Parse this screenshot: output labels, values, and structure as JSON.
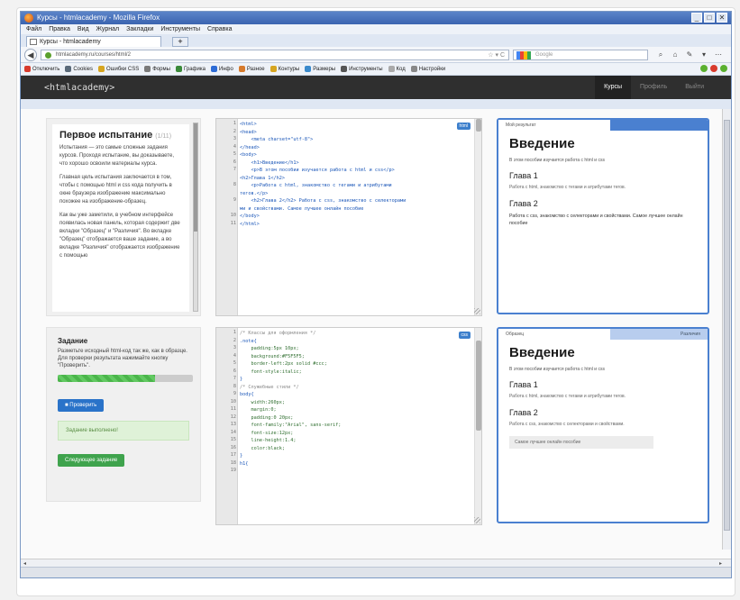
{
  "window": {
    "title": "Курсы - htmlacademy - Mozilla Firefox",
    "controls": [
      "_",
      "□",
      "✕"
    ]
  },
  "menubar": [
    "Файл",
    "Правка",
    "Вид",
    "Журнал",
    "Закладки",
    "Инструменты",
    "Справка"
  ],
  "tab": {
    "label": "Курсы - htmlacademy",
    "new_tab": "+"
  },
  "navbar": {
    "back": "◀",
    "url": "htmlacademy.ru/courses/html/2",
    "url_tail": "☆ ▾ C",
    "search_placeholder": "Google",
    "icons": [
      "⌕",
      "⌂",
      "✎",
      "▾",
      "⋯"
    ]
  },
  "bookmarks": [
    {
      "label": "Отключить",
      "color": "#d83a2c"
    },
    {
      "label": "Cookies",
      "color": "#5a6a7a"
    },
    {
      "label": "Ошибки CSS",
      "color": "#d6a520"
    },
    {
      "label": "Формы",
      "color": "#7a7a7a"
    },
    {
      "label": "Графика",
      "color": "#3a8a3a"
    },
    {
      "label": "Инфо",
      "color": "#2c6bd6"
    },
    {
      "label": "Разное",
      "color": "#d67a2c"
    },
    {
      "label": "Контуры",
      "color": "#d6a520"
    },
    {
      "label": "Размеры",
      "color": "#3a8acc"
    },
    {
      "label": "Инструменты",
      "color": "#555"
    },
    {
      "label": "Код",
      "color": "#aaa"
    },
    {
      "label": "Настройки",
      "color": "#888"
    }
  ],
  "bookbar_status_colors": [
    "#5ab030",
    "#d83a2c",
    "#5ab030"
  ],
  "app": {
    "logo": "<htmlacademy>",
    "nav": [
      "Курсы",
      "Профиль",
      "Выйти"
    ]
  },
  "theory": {
    "title": "Первое испытание",
    "meta": "(1/11)",
    "paragraphs": [
      "Испытания — это самые сложные задания курсов. Проходя испытание, вы доказываете, что хорошо освоили материалы курса.",
      "Главная цель испытания заключается в том, чтобы с помощью html и css кода получить в окне браузера изображение максимально похожее на изображение-образец.",
      "Как вы уже заметили, в учебном интерфейсе появилась новая панель, которая содержит две вкладки \"Образец\" и \"Различия\". Во вкладке \"Образец\" отображается ваше задание, а во вкладке \"Различия\" отображается изображение с помощью"
    ]
  },
  "task": {
    "title": "Задание",
    "text": "Разметьте исходный html-код так же, как в образце. Для проверки результата нажимайте кнопку \"Проверить\".",
    "progress": 0.72,
    "check_label": "Проверить",
    "success": "Задание выполнено!",
    "next_label": "Следующее задание"
  },
  "html_editor": {
    "badge": "html",
    "lines": [
      {
        "n": "1",
        "code": "<html>"
      },
      {
        "n": "2",
        "code": "<head>"
      },
      {
        "n": "3",
        "code": "    <meta charset=\"utf-8\">"
      },
      {
        "n": "4",
        "code": "</head>"
      },
      {
        "n": "5",
        "code": "<body>"
      },
      {
        "n": "6",
        "code": "    <h1>Введение</h1>"
      },
      {
        "n": "7",
        "code": "    <p>В этом пособии изучается работа с html и css</p>"
      },
      {
        "n": "",
        "code": "<h2>Глава 1</h2>"
      },
      {
        "n": "8",
        "code": "    <p>Работа с html, знакомство с тегами и атрибутами"
      },
      {
        "n": "",
        "code": "тегов.</p>"
      },
      {
        "n": "9",
        "code": "    <h2>Глава 2</h2> Работа с css, знакомство с селекторами"
      },
      {
        "n": "",
        "code": "ми и свойствами. Самое лучшее онлайн пособие"
      },
      {
        "n": "10",
        "code": "</body>"
      },
      {
        "n": "11",
        "code": "</html>"
      }
    ]
  },
  "css_editor": {
    "badge": "css",
    "lines": [
      {
        "n": "1",
        "code": "/* Классы для оформления */"
      },
      {
        "n": "2",
        "code": ".note{"
      },
      {
        "n": "3",
        "code": "    padding:5px 10px;"
      },
      {
        "n": "4",
        "code": "    background:#F5F5F5;"
      },
      {
        "n": "5",
        "code": "    border-left:2px solid #ccc;"
      },
      {
        "n": "6",
        "code": "    font-style:italic;"
      },
      {
        "n": "7",
        "code": "}"
      },
      {
        "n": "8",
        "code": ""
      },
      {
        "n": "9",
        "code": "/* Служебные стили */"
      },
      {
        "n": "10",
        "code": "body{"
      },
      {
        "n": "11",
        "code": "    width:260px;"
      },
      {
        "n": "12",
        "code": "    margin:0;"
      },
      {
        "n": "13",
        "code": "    padding:0 20px;"
      },
      {
        "n": "14",
        "code": "    font-family:\"Arial\", sans-serif;"
      },
      {
        "n": "15",
        "code": "    font-size:12px;"
      },
      {
        "n": "16",
        "code": "    line-height:1.4;"
      },
      {
        "n": "17",
        "code": "    color:black;"
      },
      {
        "n": "18",
        "code": "}"
      },
      {
        "n": "19",
        "code": "h1{"
      }
    ]
  },
  "preview_top": {
    "tab": "Мой результат",
    "h1": "Введение",
    "intro": "В этом пособии изучается работа с html и css",
    "h2a": "Глава 1",
    "p1": "Работа с html, знакомство с тегами и атрибутами тегов.",
    "h2b": "Глава 2",
    "p2": "Работа с css, знакомство с селекторами и свойствами. Самое лучшее онлайн пособие"
  },
  "preview_bottom": {
    "tab1": "Образец",
    "tab2": "Различия",
    "h1": "Введение",
    "intro": "В этом пособии изучается работа с html и css",
    "h2a": "Глава 1",
    "p1": "Работа с html, знакомство с тегами и атрибутами тегов.",
    "h2b": "Глава 2",
    "p2": "Работа с css, знакомство с селекторами и свойствами.",
    "note": "Самое лучшее онлайн пособие"
  },
  "colors": {
    "accent": "#4a80d0",
    "header_bg": "#2f2f2f",
    "success_bg": "#dff2d8",
    "check_btn": "#2a73c9",
    "next_btn": "#3fa34d"
  }
}
